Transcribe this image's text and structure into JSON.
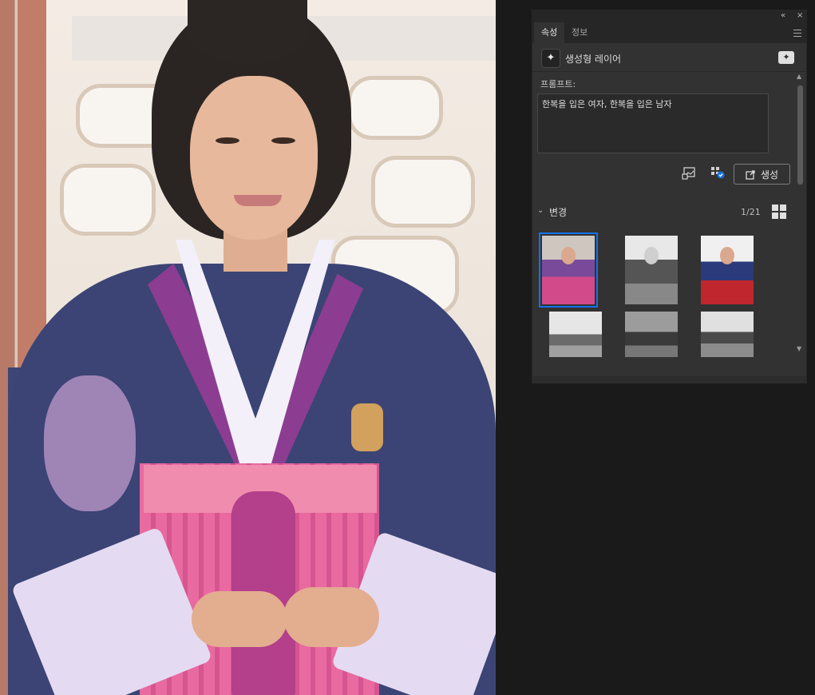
{
  "panel": {
    "tabs": [
      {
        "label": "속성",
        "active": true
      },
      {
        "label": "정보",
        "active": false
      }
    ],
    "collapse_glyph": "«",
    "close_glyph": "×",
    "layer": {
      "icon": "sparkle-icon",
      "label": "생성형 레이어"
    },
    "prompt": {
      "label": "프롬프트:",
      "value": "한복을 입은 여자, 한복을 입은 남자"
    },
    "generate_button": {
      "label": "생성"
    },
    "variations": {
      "title": "변경",
      "count": "1/21",
      "selected_index": 0,
      "thumbnails": [
        {
          "name": "variation-thumbnail-1",
          "tone": "color"
        },
        {
          "name": "variation-thumbnail-2",
          "tone": "grayscale"
        },
        {
          "name": "variation-thumbnail-3",
          "tone": "color"
        },
        {
          "name": "variation-thumbnail-4",
          "tone": "grayscale"
        },
        {
          "name": "variation-thumbnail-5",
          "tone": "grayscale"
        },
        {
          "name": "variation-thumbnail-6",
          "tone": "grayscale"
        }
      ]
    }
  },
  "colors": {
    "app_background": "#1a1a1a",
    "panel_background": "#323232",
    "selection_accent": "#1473e6"
  }
}
